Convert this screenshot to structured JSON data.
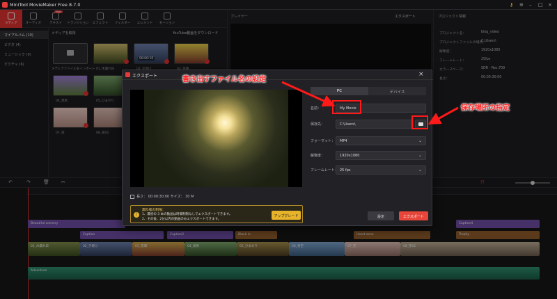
{
  "app": {
    "title": "MiniTool MovieMaker Free 8.7.0"
  },
  "toolbar": {
    "items": [
      {
        "label": "メディア"
      },
      {
        "label": "オーディオ"
      },
      {
        "label": "テキスト"
      },
      {
        "label": "トランジション"
      },
      {
        "label": "エフェクト"
      },
      {
        "label": "フィルター"
      },
      {
        "label": "エレメント"
      },
      {
        "label": "モーション"
      }
    ],
    "new_badge": "New"
  },
  "sidebar": {
    "items": [
      {
        "label": "マイアルバム (10)"
      },
      {
        "label": "ビデオ (4)"
      },
      {
        "label": "ミュージック (0)"
      },
      {
        "label": "ピクチャ (6)"
      }
    ]
  },
  "media": {
    "import_label": "メディアを取得",
    "youtube_label": "YouTube動画をダウンロード",
    "import_tile": "メディアファイルをインポート",
    "items": [
      {
        "label": "01_木漏れ日"
      },
      {
        "label": "02_夕焼け"
      },
      {
        "label": "03_花畑"
      },
      {
        "label": "04_草原"
      },
      {
        "label": "05_ひまわり"
      },
      {
        "label": "06_青空"
      },
      {
        "label": "07_花"
      },
      {
        "label": "08_花02"
      },
      {
        "label": "09_花03"
      }
    ],
    "duration": "00:00:10"
  },
  "player": {
    "label": "プレイヤー",
    "export_label": "エクスポート"
  },
  "props": {
    "title": "プロジェクト情報",
    "rows": [
      {
        "k": "プロジェクト名：",
        "v": "blog_video"
      },
      {
        "k": "プロジェクトファイルの場所：",
        "v": "C:\\Users\\"
      },
      {
        "k": "解像度：",
        "v": "1920x1080"
      },
      {
        "k": "フレームレート：",
        "v": "25fps"
      },
      {
        "k": "カラースペース：",
        "v": "SDR - Rec.709"
      },
      {
        "k": "長さ：",
        "v": "00:00:30:00"
      }
    ]
  },
  "timeline": {
    "clips_text": [
      "Beautiful scenery",
      "Caption",
      "Caption2",
      "Caption3",
      "Caption4",
      "Black in",
      "Heart zone",
      "Trophy"
    ],
    "video_clips": [
      "01_木漏れ日",
      "02_夕焼け",
      "03_花畑",
      "04_草原",
      "05_ひまわり",
      "06_青空",
      "07_花",
      "08_花02"
    ],
    "audio_label": "Adventure"
  },
  "modal": {
    "title": "エクスポート",
    "tabs": {
      "pc": "PC",
      "device": "デバイス"
    },
    "fields": {
      "name_label": "名前：",
      "name_value": "My Movie",
      "save_label": "保存先：",
      "save_value": "C:\\Users\\",
      "format_label": "フォーマット：",
      "format_value": "MP4",
      "resolution_label": "解像度：",
      "resolution_value": "1920x1080",
      "framerate_label": "フレームレート：",
      "framerate_value": "25 fps"
    },
    "info": "長さ： 00:00:30:00  サイズ： 30 M",
    "notice": {
      "title": "無料版の制限：",
      "line1": "1、最初の 3 本の動画は時間制限なしでエクスポートできます。",
      "line2": "2、その後、2分以内の動画のみエクスポートできます。",
      "upgrade": "アップグレード"
    },
    "settings_button": "設定",
    "export_button": "エクスポート"
  },
  "annotations": {
    "filename": "書き出すファイル名の設定",
    "location": "保存場所の指定",
    "color": "#ff1a1a"
  }
}
